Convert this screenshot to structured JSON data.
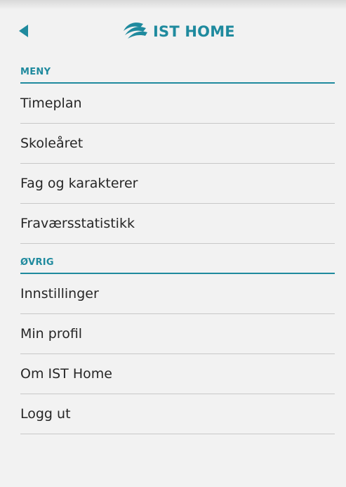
{
  "header": {
    "back_icon": "back-arrow-icon",
    "logo_icon": "ist-swoosh-icon",
    "logo_text": "IST HOME",
    "accent_color": "#1f8a9e"
  },
  "sections": [
    {
      "title": "MENY",
      "items": [
        "Timeplan",
        "Skoleåret",
        "Fag og karakterer",
        "Fraværsstatistikk"
      ]
    },
    {
      "title": "ØVRIG",
      "items": [
        "Innstillinger",
        "Min profil",
        "Om IST Home",
        "Logg ut"
      ]
    }
  ]
}
